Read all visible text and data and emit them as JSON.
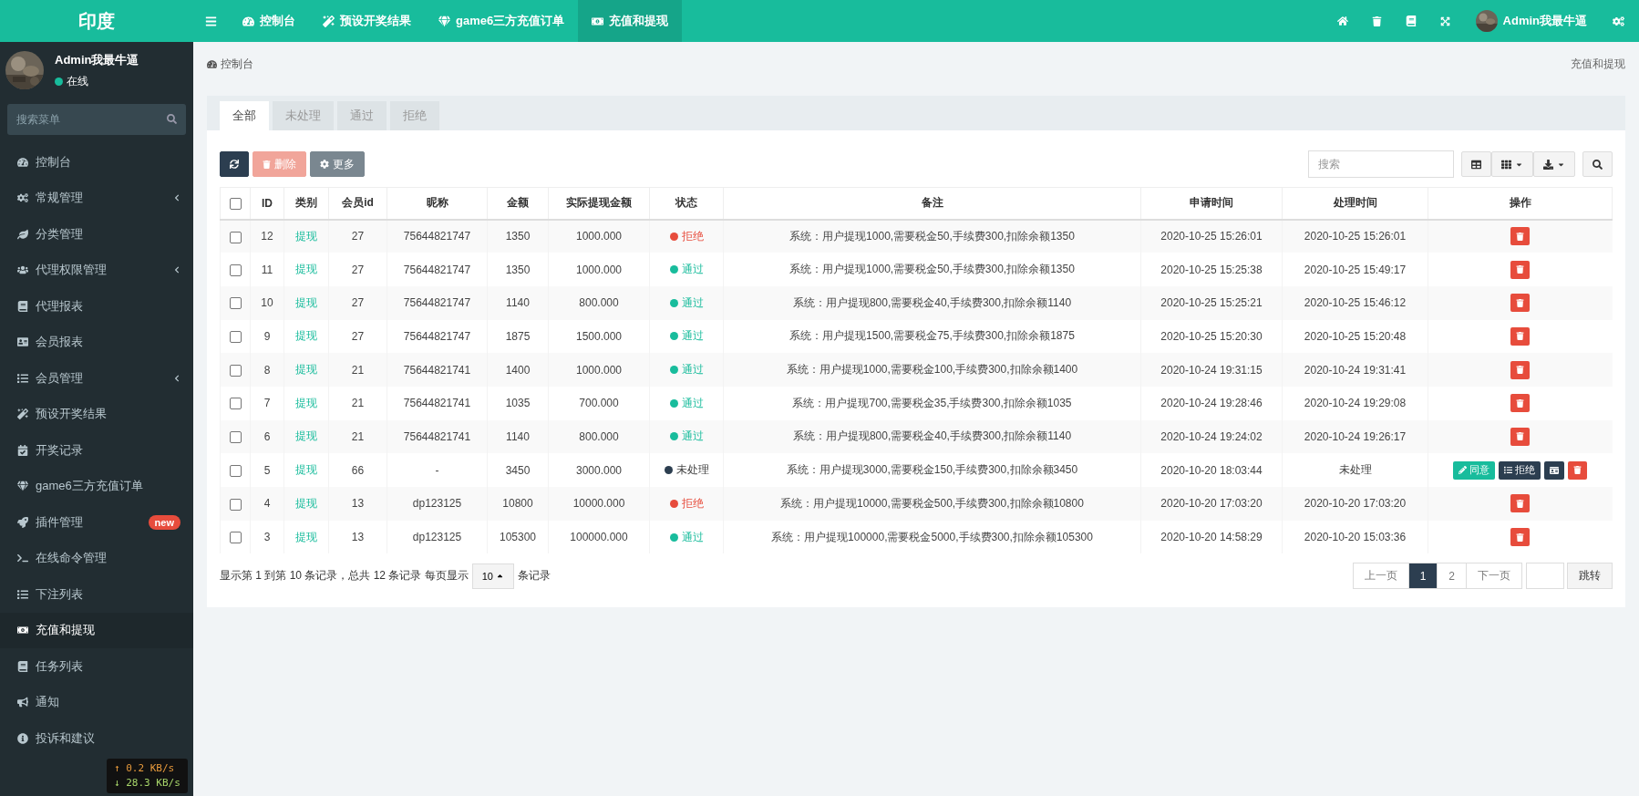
{
  "brand": "印度",
  "top_nav": [
    {
      "label": "控制台",
      "selected": false
    },
    {
      "label": "预设开奖结果",
      "selected": false
    },
    {
      "label": "game6三方充值订单",
      "selected": false
    },
    {
      "label": "充值和提现",
      "selected": true
    }
  ],
  "top_user": "Admin我最牛逼",
  "sidebar": {
    "user": {
      "name": "Admin我最牛逼",
      "status": "在线"
    },
    "search": {
      "placeholder": "搜索菜单"
    },
    "items": [
      {
        "label": "控制台",
        "has_submenu": false,
        "selected": false
      },
      {
        "label": "常规管理",
        "has_submenu": true,
        "selected": false
      },
      {
        "label": "分类管理",
        "has_submenu": false,
        "selected": false
      },
      {
        "label": "代理权限管理",
        "has_submenu": true,
        "selected": false
      },
      {
        "label": "代理报表",
        "has_submenu": false,
        "selected": false
      },
      {
        "label": "会员报表",
        "has_submenu": false,
        "selected": false
      },
      {
        "label": "会员管理",
        "has_submenu": true,
        "selected": false
      },
      {
        "label": "预设开奖结果",
        "has_submenu": false,
        "selected": false
      },
      {
        "label": "开奖记录",
        "has_submenu": false,
        "selected": false
      },
      {
        "label": "game6三方充值订单",
        "has_submenu": false,
        "selected": false
      },
      {
        "label": "插件管理",
        "has_submenu": false,
        "selected": false,
        "badge": "new"
      },
      {
        "label": "在线命令管理",
        "has_submenu": false,
        "selected": false
      },
      {
        "label": "下注列表",
        "has_submenu": false,
        "selected": false
      },
      {
        "label": "充值和提现",
        "has_submenu": false,
        "selected": true
      },
      {
        "label": "任务列表",
        "has_submenu": false,
        "selected": false
      },
      {
        "label": "通知",
        "has_submenu": false,
        "selected": false
      },
      {
        "label": "投诉和建议",
        "has_submenu": false,
        "selected": false
      }
    ]
  },
  "net_speed": {
    "up": "↑ 0.2 KB/s",
    "down": "↓ 28.3 KB/s"
  },
  "breadcrumb": {
    "home": "控制台",
    "current": "充值和提现"
  },
  "tabs": [
    {
      "label": "全部",
      "selected": true
    },
    {
      "label": "未处理",
      "selected": false
    },
    {
      "label": "通过",
      "selected": false
    },
    {
      "label": "拒绝",
      "selected": false
    }
  ],
  "toolbar": {
    "delete": "删除",
    "more": "更多",
    "search_placeholder": "搜索"
  },
  "table": {
    "header_checked": false,
    "columns": [
      "ID",
      "类别",
      "会员id",
      "昵称",
      "金额",
      "实际提现金额",
      "状态",
      "备注",
      "申请时间",
      "处理时间",
      "操作"
    ],
    "rows": [
      {
        "checked": false,
        "id": "12",
        "category": "提现",
        "member_id": "27",
        "nickname": "75644821747",
        "amount": "1350",
        "actual": "1000.000",
        "status": "拒绝",
        "color": "#e74c3c",
        "note": "系统：用户提现1000,需要税金50,手续费300,扣除余额1350",
        "apply_time": "2020-10-25 15:26:01",
        "process_time": "2020-10-25 15:26:01",
        "kind": "done"
      },
      {
        "checked": false,
        "id": "11",
        "category": "提现",
        "member_id": "27",
        "nickname": "75644821747",
        "amount": "1350",
        "actual": "1000.000",
        "status": "通过",
        "color": "#18bc9c",
        "note": "系统：用户提现1000,需要税金50,手续费300,扣除余额1350",
        "apply_time": "2020-10-25 15:25:38",
        "process_time": "2020-10-25 15:49:17",
        "kind": "done"
      },
      {
        "checked": false,
        "id": "10",
        "category": "提现",
        "member_id": "27",
        "nickname": "75644821747",
        "amount": "1140",
        "actual": "800.000",
        "status": "通过",
        "color": "#18bc9c",
        "note": "系统：用户提现800,需要税金40,手续费300,扣除余额1140",
        "apply_time": "2020-10-25 15:25:21",
        "process_time": "2020-10-25 15:46:12",
        "kind": "done"
      },
      {
        "checked": false,
        "id": "9",
        "category": "提现",
        "member_id": "27",
        "nickname": "75644821747",
        "amount": "1875",
        "actual": "1500.000",
        "status": "通过",
        "color": "#18bc9c",
        "note": "系统：用户提现1500,需要税金75,手续费300,扣除余额1875",
        "apply_time": "2020-10-25 15:20:30",
        "process_time": "2020-10-25 15:20:48",
        "kind": "done"
      },
      {
        "checked": false,
        "id": "8",
        "category": "提现",
        "member_id": "21",
        "nickname": "75644821741",
        "amount": "1400",
        "actual": "1000.000",
        "status": "通过",
        "color": "#18bc9c",
        "note": "系统：用户提现1000,需要税金100,手续费300,扣除余额1400",
        "apply_time": "2020-10-24 19:31:15",
        "process_time": "2020-10-24 19:31:41",
        "kind": "done"
      },
      {
        "checked": false,
        "id": "7",
        "category": "提现",
        "member_id": "21",
        "nickname": "75644821741",
        "amount": "1035",
        "actual": "700.000",
        "status": "通过",
        "color": "#18bc9c",
        "note": "系统：用户提现700,需要税金35,手续费300,扣除余额1035",
        "apply_time": "2020-10-24 19:28:46",
        "process_time": "2020-10-24 19:29:08",
        "kind": "done"
      },
      {
        "checked": false,
        "id": "6",
        "category": "提现",
        "member_id": "21",
        "nickname": "75644821741",
        "amount": "1140",
        "actual": "800.000",
        "status": "通过",
        "color": "#18bc9c",
        "note": "系统：用户提现800,需要税金40,手续费300,扣除余额1140",
        "apply_time": "2020-10-24 19:24:02",
        "process_time": "2020-10-24 19:26:17",
        "kind": "done"
      },
      {
        "checked": false,
        "id": "5",
        "category": "提现",
        "member_id": "66",
        "nickname": "-",
        "amount": "3450",
        "actual": "3000.000",
        "status": "未处理",
        "color": "#2c3e50",
        "note": "系统：用户提现3000,需要税金150,手续费300,扣除余额3450",
        "apply_time": "2020-10-20 18:03:44",
        "process_time": "未处理",
        "kind": "pending",
        "approve": "同意",
        "reject": "拒绝"
      },
      {
        "checked": false,
        "id": "4",
        "category": "提现",
        "member_id": "13",
        "nickname": "dp123125",
        "amount": "10800",
        "actual": "10000.000",
        "status": "拒绝",
        "color": "#e74c3c",
        "note": "系统：用户提现10000,需要税金500,手续费300,扣除余额10800",
        "apply_time": "2020-10-20 17:03:20",
        "process_time": "2020-10-20 17:03:20",
        "kind": "done"
      },
      {
        "checked": false,
        "id": "3",
        "category": "提现",
        "member_id": "13",
        "nickname": "dp123125",
        "amount": "105300",
        "actual": "100000.000",
        "status": "通过",
        "color": "#18bc9c",
        "note": "系统：用户提现100000,需要税金5000,手续费300,扣除余额105300",
        "apply_time": "2020-10-20 14:58:29",
        "process_time": "2020-10-20 15:03:36",
        "kind": "done"
      }
    ]
  },
  "pagination": {
    "summary_start": "显示第 1 到第 10 条记录，总共 12 条记录 每页显示",
    "page_size": "10",
    "summary_end": "条记录",
    "prev": "上一页",
    "pages": [
      {
        "label": "1",
        "selected": true
      },
      {
        "label": "2",
        "selected": false
      }
    ],
    "next": "下一页",
    "go": "跳转"
  }
}
